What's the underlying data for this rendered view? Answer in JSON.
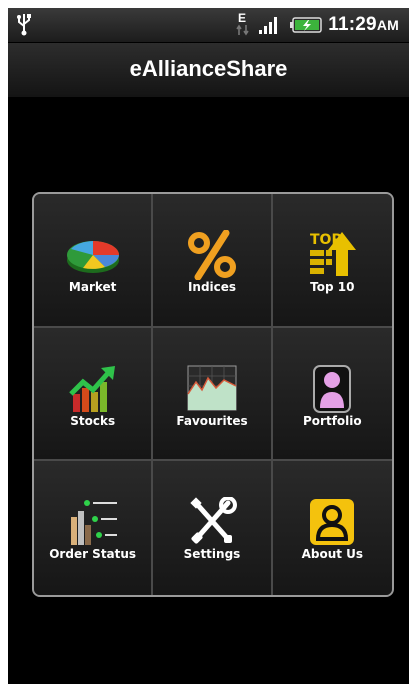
{
  "status_bar": {
    "network_letter": "E",
    "time": "11:29",
    "ampm": "AM",
    "icons": [
      "usb-icon",
      "edge-network-icon",
      "signal-bars-icon",
      "battery-charging-icon"
    ]
  },
  "app": {
    "title": "eAllianceShare"
  },
  "menu": {
    "items": [
      {
        "label": "Market",
        "icon": "pie-chart-icon"
      },
      {
        "label": "Indices",
        "icon": "percent-icon"
      },
      {
        "label": "Top 10",
        "icon": "top-ten-icon"
      },
      {
        "label": "Stocks",
        "icon": "rising-bars-icon"
      },
      {
        "label": "Favourites",
        "icon": "area-chart-icon"
      },
      {
        "label": "Portfolio",
        "icon": "person-icon"
      },
      {
        "label": "Order Status",
        "icon": "order-list-icon"
      },
      {
        "label": "Settings",
        "icon": "tools-icon"
      },
      {
        "label": "About Us",
        "icon": "contact-icon"
      }
    ]
  },
  "colors": {
    "background": "#000000",
    "tile_border": "#4a4a4a",
    "panel_border": "#9a9a9a",
    "text": "#ffffff",
    "indices_orange": "#f0a020",
    "top_yellow": "#e8c000",
    "about_yellow": "#f4c20d",
    "portfolio_pink": "#e4a0e6"
  }
}
